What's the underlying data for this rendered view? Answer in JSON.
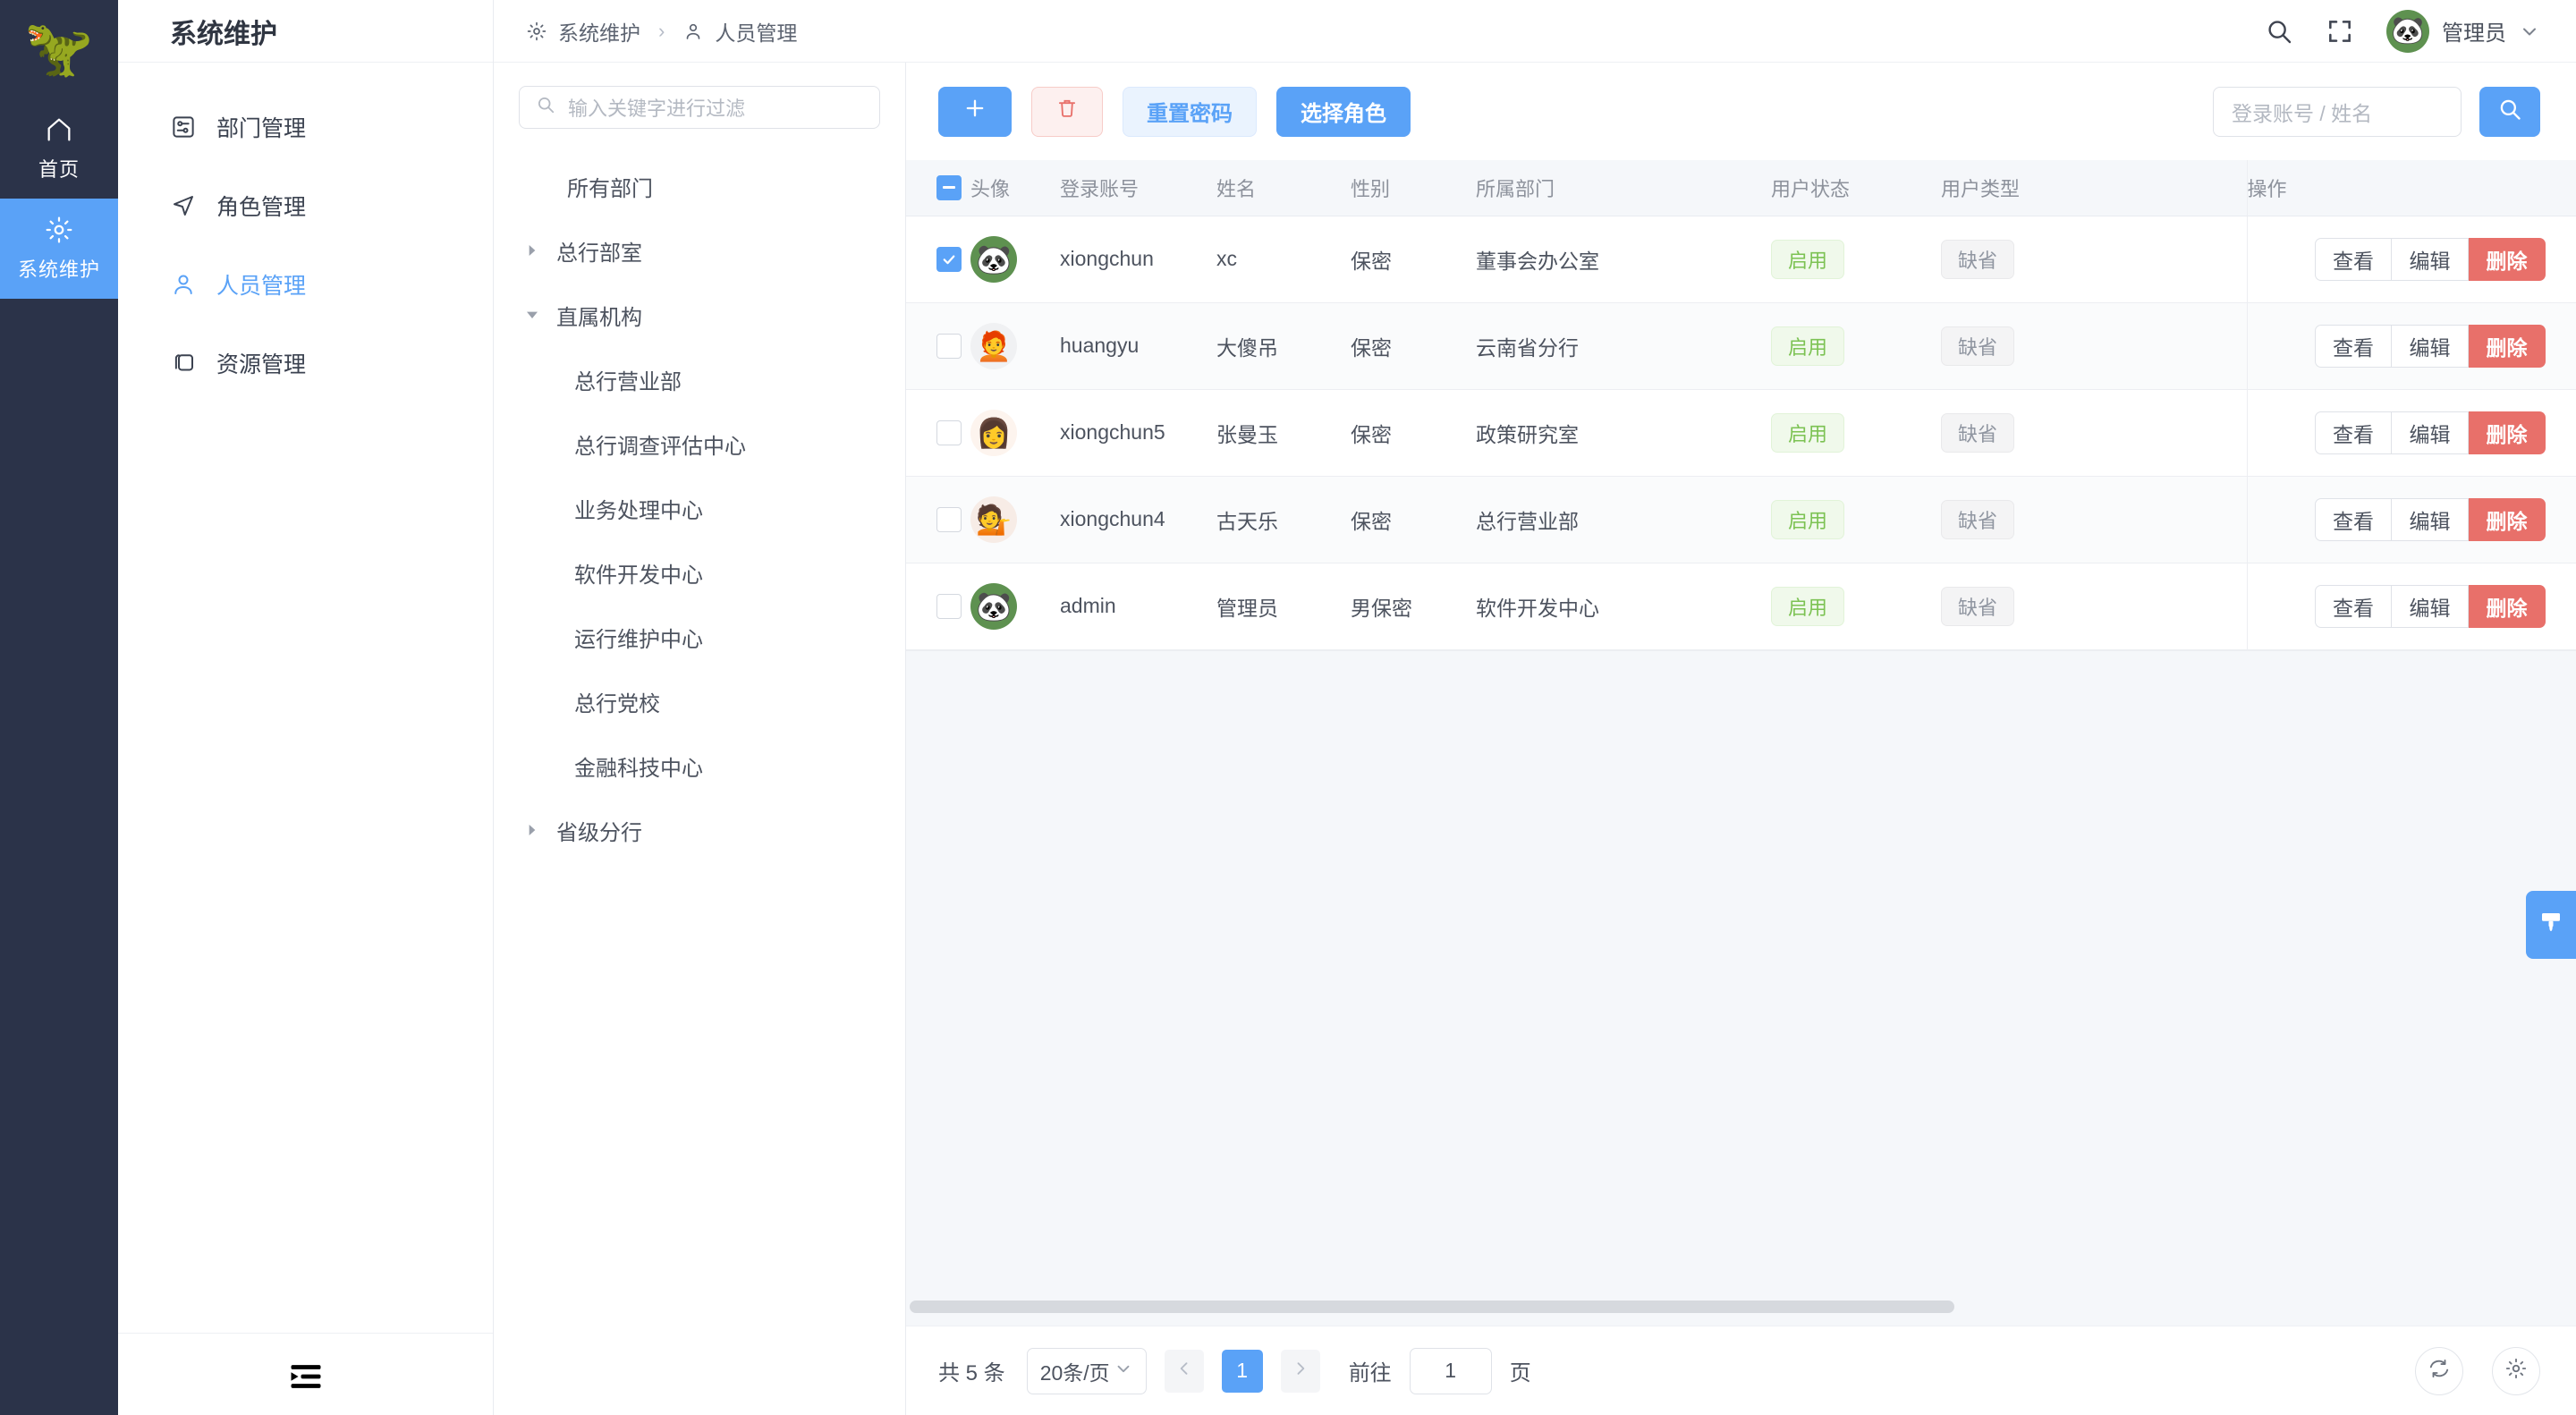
{
  "rail": {
    "logo_icon": "dinosaur-logo",
    "items": [
      {
        "label": "首页",
        "icon": "home-icon",
        "active": false
      },
      {
        "label": "系统维护",
        "icon": "gear-icon",
        "active": true
      }
    ]
  },
  "modnav": {
    "title": "系统维护",
    "items": [
      {
        "label": "部门管理",
        "icon": "department-icon",
        "active": false
      },
      {
        "label": "角色管理",
        "icon": "send-icon",
        "active": false
      },
      {
        "label": "人员管理",
        "icon": "user-icon",
        "active": true
      },
      {
        "label": "资源管理",
        "icon": "copy-icon",
        "active": false
      }
    ],
    "collapse_icon": "menu-fold-icon"
  },
  "topbar": {
    "breadcrumb": [
      {
        "label": "系统维护",
        "icon": "gear-icon"
      },
      {
        "label": "人员管理",
        "icon": "user-icon"
      }
    ],
    "separator": "›",
    "search_icon": "search-icon",
    "fullscreen_icon": "fullscreen-icon",
    "user": {
      "name": "管理员",
      "avatar_icon": "panda-avatar",
      "caret_icon": "chevron-down-icon"
    }
  },
  "tree": {
    "filter_placeholder": "输入关键字进行过滤",
    "filter_icon": "search-icon",
    "nodes": [
      {
        "label": "所有部门",
        "level": 0,
        "arrow": "none"
      },
      {
        "label": "总行部室",
        "level": 0,
        "arrow": "collapsed"
      },
      {
        "label": "直属机构",
        "level": 0,
        "arrow": "expanded"
      },
      {
        "label": "总行营业部",
        "level": 1,
        "arrow": "none"
      },
      {
        "label": "总行调查评估中心",
        "level": 1,
        "arrow": "none"
      },
      {
        "label": "业务处理中心",
        "level": 1,
        "arrow": "none"
      },
      {
        "label": "软件开发中心",
        "level": 1,
        "arrow": "none"
      },
      {
        "label": "运行维护中心",
        "level": 1,
        "arrow": "none"
      },
      {
        "label": "总行党校",
        "level": 1,
        "arrow": "none"
      },
      {
        "label": "金融科技中心",
        "level": 1,
        "arrow": "none"
      },
      {
        "label": "省级分行",
        "level": 0,
        "arrow": "collapsed"
      }
    ]
  },
  "toolbar": {
    "add_icon": "plus-icon",
    "delete_icon": "trash-icon",
    "reset_password_label": "重置密码",
    "select_role_label": "选择角色",
    "search_placeholder": "登录账号 / 姓名",
    "search_value": "",
    "search_button_icon": "search-icon"
  },
  "table": {
    "headers": [
      "头像",
      "登录账号",
      "姓名",
      "性别",
      "所属部门",
      "用户状态",
      "用户类型",
      "操作"
    ],
    "header_select_state": "indeterminate",
    "rows": [
      {
        "checked": true,
        "avatar_icon": "panda-avatar",
        "account": "xiongchun",
        "name": "xc",
        "gender": "保密",
        "dept": "董事会办公室",
        "status": "启用",
        "type": "缺省"
      },
      {
        "checked": false,
        "avatar_icon": "man-avatar",
        "account": "huangyu",
        "name": "大傻吊",
        "gender": "保密",
        "dept": "云南省分行",
        "status": "启用",
        "type": "缺省"
      },
      {
        "checked": false,
        "avatar_icon": "woman-avatar",
        "account": "xiongchun5",
        "name": "张曼玉",
        "gender": "保密",
        "dept": "政策研究室",
        "status": "启用",
        "type": "缺省"
      },
      {
        "checked": false,
        "avatar_icon": "woman2-avatar",
        "account": "xiongchun4",
        "name": "古天乐",
        "gender": "保密",
        "dept": "总行营业部",
        "status": "启用",
        "type": "缺省"
      },
      {
        "checked": false,
        "avatar_icon": "panda-avatar",
        "account": "admin",
        "name": "管理员",
        "gender": "男保密",
        "dept": "软件开发中心",
        "status": "启用",
        "type": "缺省"
      }
    ],
    "actions": {
      "view": "查看",
      "edit": "编辑",
      "delete": "删除"
    },
    "theme_tab_icon": "brush-icon"
  },
  "footer": {
    "total_label": "共 5 条",
    "page_size": "20条/页",
    "page_size_caret": "chevron-down-icon",
    "prev_icon": "chevron-left-icon",
    "next_icon": "chevron-right-icon",
    "current_page": "1",
    "jump_label": "前往",
    "jump_value": "1",
    "jump_unit": "页",
    "refresh_icon": "refresh-icon",
    "settings_icon": "gear-icon"
  },
  "colors": {
    "rail_bg": "#2b3349",
    "accent": "#5aa2f7",
    "danger": "#e8706a",
    "success": "#7cc253",
    "header_bg": "#f5f7fa"
  }
}
